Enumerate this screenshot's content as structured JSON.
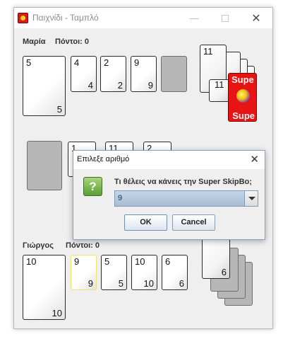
{
  "window": {
    "title": "Παιχνίδι - Ταμπλό"
  },
  "player_top": {
    "name": "Μαρία",
    "score_label": "Πόντοι: 0",
    "stock_card": {
      "tl": "5",
      "br": "5"
    },
    "discards": [
      {
        "tl": "4",
        "br": "4"
      },
      {
        "tl": "2",
        "br": "2"
      },
      {
        "tl": "9",
        "br": "9"
      }
    ]
  },
  "build_area": {
    "deck_stack_top": "11",
    "deck_stack_mid": "11",
    "super_card": {
      "tl": "Supe",
      "br": "Supe"
    },
    "build_piles": [
      "1",
      "11",
      "2"
    ]
  },
  "player_bottom": {
    "name": "Γιώργος",
    "score_label": "Πόντοι: 0",
    "stock_card": {
      "tl": "10",
      "br": "10"
    },
    "discards": [
      {
        "tl": "9",
        "br": "9"
      },
      {
        "tl": "5",
        "br": "5"
      },
      {
        "tl": "10",
        "br": "10"
      },
      {
        "tl": "6",
        "br": "6"
      }
    ],
    "hand_stack_value": "6"
  },
  "dialog": {
    "title": "Επιλεξε αριθμό",
    "message": "Τι θέλεις να κάνεις την Super SkipBo;",
    "selected_value": "9",
    "ok_label": "OK",
    "cancel_label": "Cancel",
    "icon_glyph": "?"
  },
  "colors": {
    "super_card": "#e81313",
    "dialog_accent": "#7da2ce",
    "highlight_border": "#f0e26a"
  }
}
